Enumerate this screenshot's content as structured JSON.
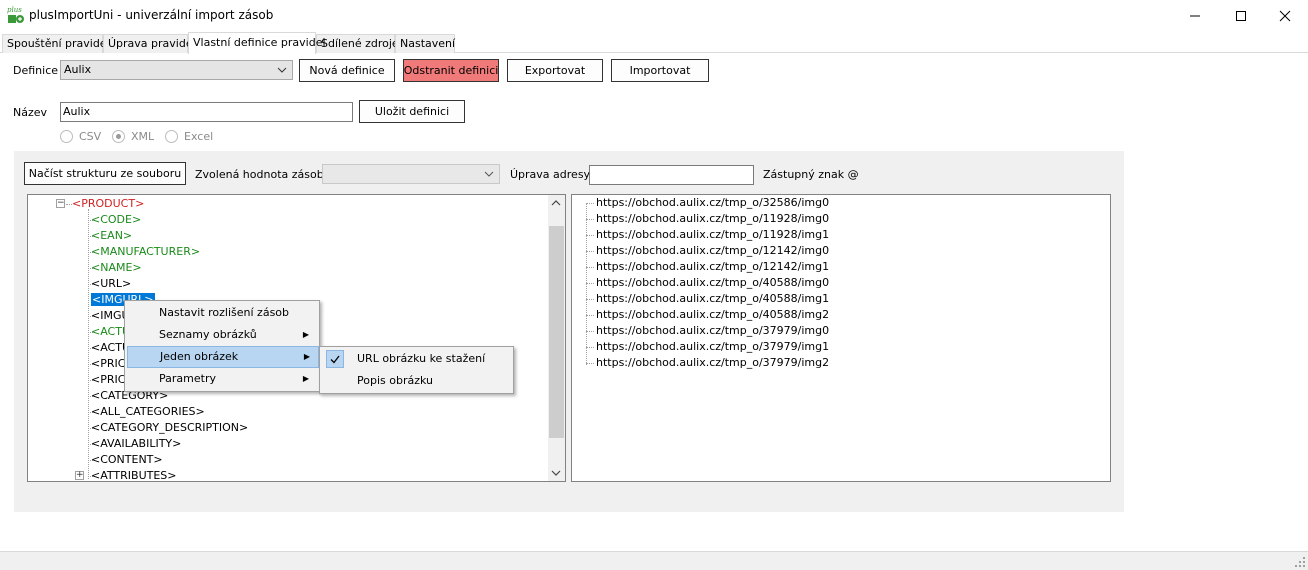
{
  "window": {
    "title": "plusImportUni - univerzální import zásob",
    "icon": "plus-app-icon"
  },
  "tabs": [
    {
      "label": "Spouštění pravidel"
    },
    {
      "label": "Úprava pravidel"
    },
    {
      "label": "Vlastní definice pravidel",
      "active": true
    },
    {
      "label": "Sdílené zdroje"
    },
    {
      "label": "Nastavení"
    }
  ],
  "definition": {
    "label": "Definice",
    "selected": "Aulix",
    "buttons": {
      "new": "Nová definice",
      "delete": "Odstranit definici",
      "export": "Exportovat",
      "import": "Importovat"
    },
    "delete_color": "#f07a7a"
  },
  "name": {
    "label": "Název",
    "value": "Aulix",
    "save": "Uložit definici"
  },
  "format": {
    "options": [
      "CSV",
      "XML",
      "Excel"
    ],
    "selected": "XML"
  },
  "structure": {
    "load_button": "Načíst strukturu ze souboru",
    "selected_value_label": "Zvolená hodnota zásoby",
    "selected_value": "",
    "address_edit_label": "Úprava adresy",
    "address_edit_value": "",
    "placeholder_label": "Zástupný znak @"
  },
  "tree": {
    "root": "<PRODUCT>",
    "nodes": [
      {
        "text": "<CODE>",
        "color": "green"
      },
      {
        "text": "<EAN>",
        "color": "green"
      },
      {
        "text": "<MANUFACTURER>",
        "color": "green"
      },
      {
        "text": "<NAME>",
        "color": "green"
      },
      {
        "text": "<URL>",
        "color": "black"
      },
      {
        "text": "<IMGURL>",
        "color": "selected"
      },
      {
        "text": "<IMGU",
        "color": "black"
      },
      {
        "text": "<ACTU",
        "color": "green"
      },
      {
        "text": "<ACTU",
        "color": "black"
      },
      {
        "text": "<PRIC",
        "color": "black"
      },
      {
        "text": "<PRIC",
        "color": "black"
      },
      {
        "text": "<CATEGORY>",
        "color": "black"
      },
      {
        "text": "<ALL_CATEGORIES>",
        "color": "black"
      },
      {
        "text": "<CATEGORY_DESCRIPTION>",
        "color": "black"
      },
      {
        "text": "<AVAILABILITY>",
        "color": "black"
      },
      {
        "text": "<CONTENT>",
        "color": "black"
      },
      {
        "text": "<ATTRIBUTES>",
        "color": "black"
      }
    ]
  },
  "url_list": [
    "https://obchod.aulix.cz/tmp_o/32586/img0",
    "https://obchod.aulix.cz/tmp_o/11928/img0",
    "https://obchod.aulix.cz/tmp_o/11928/img1",
    "https://obchod.aulix.cz/tmp_o/12142/img0",
    "https://obchod.aulix.cz/tmp_o/12142/img1",
    "https://obchod.aulix.cz/tmp_o/40588/img0",
    "https://obchod.aulix.cz/tmp_o/40588/img1",
    "https://obchod.aulix.cz/tmp_o/40588/img2",
    "https://obchod.aulix.cz/tmp_o/37979/img0",
    "https://obchod.aulix.cz/tmp_o/37979/img1",
    "https://obchod.aulix.cz/tmp_o/37979/img2"
  ],
  "context_menu": {
    "items": [
      {
        "label": "Nastavit rozlišení zásob",
        "submenu": false
      },
      {
        "label": "Seznamy obrázků",
        "submenu": true
      },
      {
        "label": "Jeden obrázek",
        "submenu": true,
        "highlighted": true
      },
      {
        "label": "Parametry",
        "submenu": true
      }
    ],
    "submenu": [
      {
        "label": "URL obrázku ke stažení",
        "checked": true
      },
      {
        "label": "Popis obrázku",
        "checked": false
      }
    ]
  }
}
